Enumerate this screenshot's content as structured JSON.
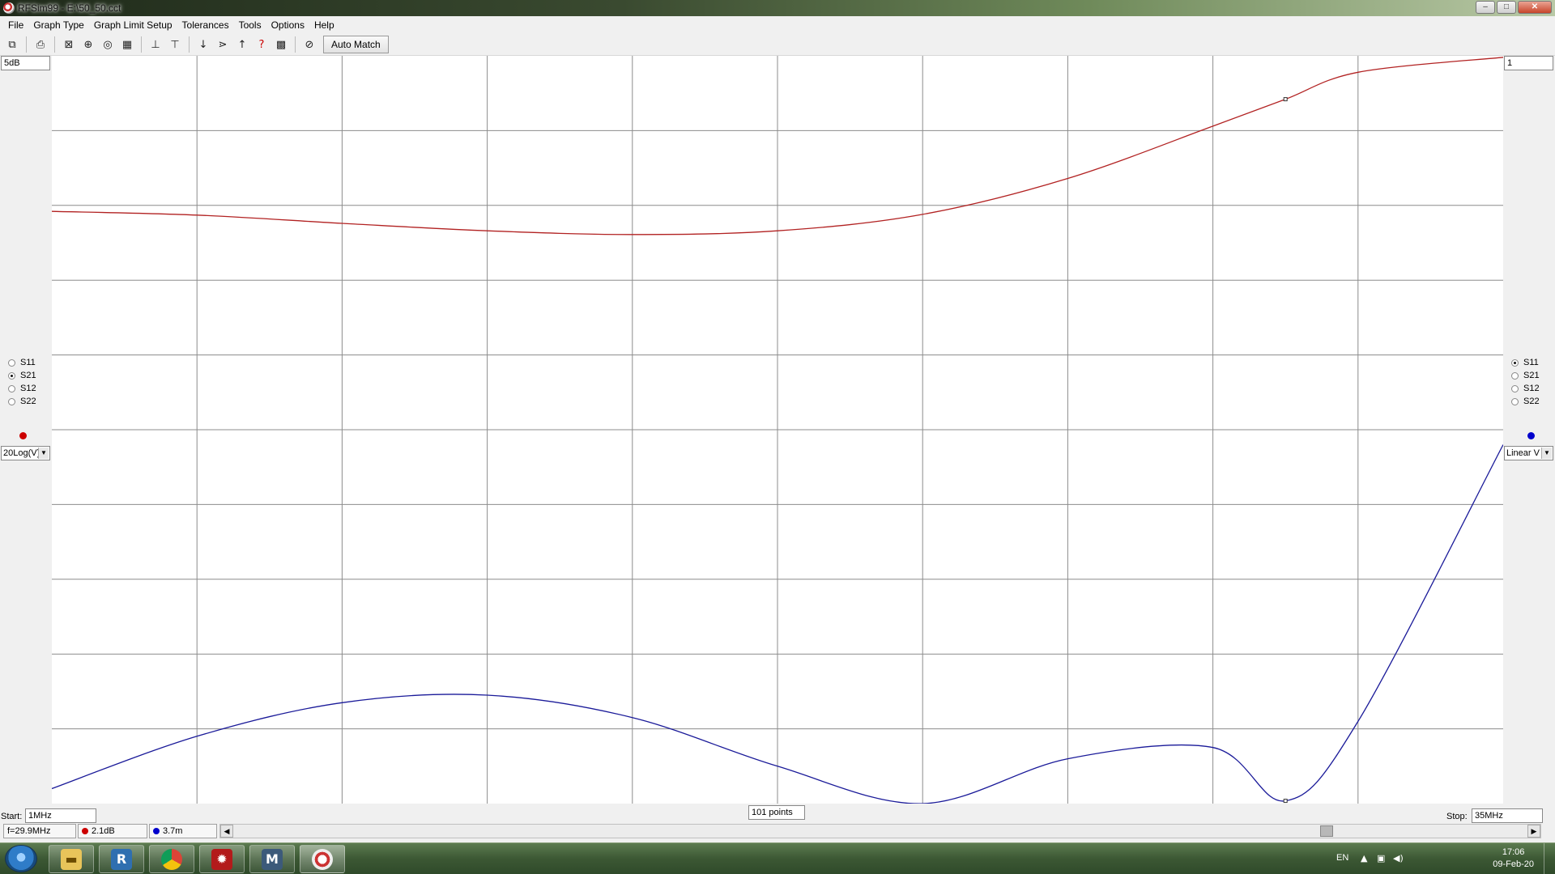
{
  "window": {
    "title": "RFSim99 - E:\\50_50.cct",
    "controls": {
      "minimize": "–",
      "maximize": "□",
      "close": "✕"
    }
  },
  "menu": [
    "File",
    "Graph Type",
    "Graph Limit Setup",
    "Tolerances",
    "Tools",
    "Options",
    "Help"
  ],
  "toolbar": {
    "icons": [
      "open-schematic-icon",
      "print-icon",
      "graph-icon",
      "smith-chart-icon",
      "polar-chart-icon",
      "table-icon",
      "scale-down-icon",
      "scale-up-icon",
      "arrow-down-icon",
      "marker-compress-icon",
      "arrow-up-icon",
      "help-query-icon",
      "component-icon",
      "match-icon"
    ],
    "auto_match_label": "Auto Match"
  },
  "left_panel": {
    "scale_top": "5dB",
    "params": [
      {
        "label": "S11",
        "selected": false
      },
      {
        "label": "S21",
        "selected": true
      },
      {
        "label": "S12",
        "selected": false
      },
      {
        "label": "S22",
        "selected": false
      }
    ],
    "trace_color": "#cc0000",
    "mode": "20Log(V)"
  },
  "right_panel": {
    "scale_top": "1",
    "params": [
      {
        "label": "S11",
        "selected": true
      },
      {
        "label": "S21",
        "selected": false
      },
      {
        "label": "S12",
        "selected": false
      },
      {
        "label": "S22",
        "selected": false
      }
    ],
    "trace_color": "#0000cc",
    "mode": "Linear V"
  },
  "chart_data": {
    "type": "line",
    "x": [
      1,
      4.4,
      7.8,
      11.2,
      14.6,
      18,
      21.4,
      24.8,
      28.2,
      29.9,
      31.6,
      35
    ],
    "xlim": [
      1,
      35
    ],
    "grid": true,
    "series": [
      {
        "name": "S21",
        "color": "#b22222",
        "values": [
          -5.4,
          -5.65,
          -6.2,
          -6.7,
          -6.95,
          -6.7,
          -5.6,
          -3.2,
          0.3,
          2.1,
          3.9,
          4.9
        ],
        "ylim": [
          -45,
          5
        ]
      },
      {
        "name": "S11",
        "color": "#1a1a99",
        "values": [
          0.02,
          0.09,
          0.135,
          0.145,
          0.115,
          0.05,
          0.0,
          0.06,
          0.075,
          0.0037,
          0.11,
          0.48
        ],
        "ylim": [
          0,
          1
        ]
      }
    ],
    "markers": [
      {
        "series": "S21",
        "x": 29.9,
        "y": 2.1
      },
      {
        "series": "S11",
        "x": 29.9,
        "y": 0.0037
      }
    ]
  },
  "bottom": {
    "start_label": "Start:",
    "start_value": "1MHz",
    "points": "101 points",
    "stop_label": "Stop:",
    "stop_value": "35MHz",
    "marker_freq": "f=29.9MHz",
    "marker_s21": "2.1dB",
    "marker_s11": "3.7m"
  },
  "taskbar": {
    "apps": [
      "file-explorer",
      "rf-tool",
      "chrome",
      "antivirus",
      "matlab",
      "rfsim99"
    ],
    "lang": "EN",
    "time": "17:06",
    "date": "09-Feb-20"
  }
}
